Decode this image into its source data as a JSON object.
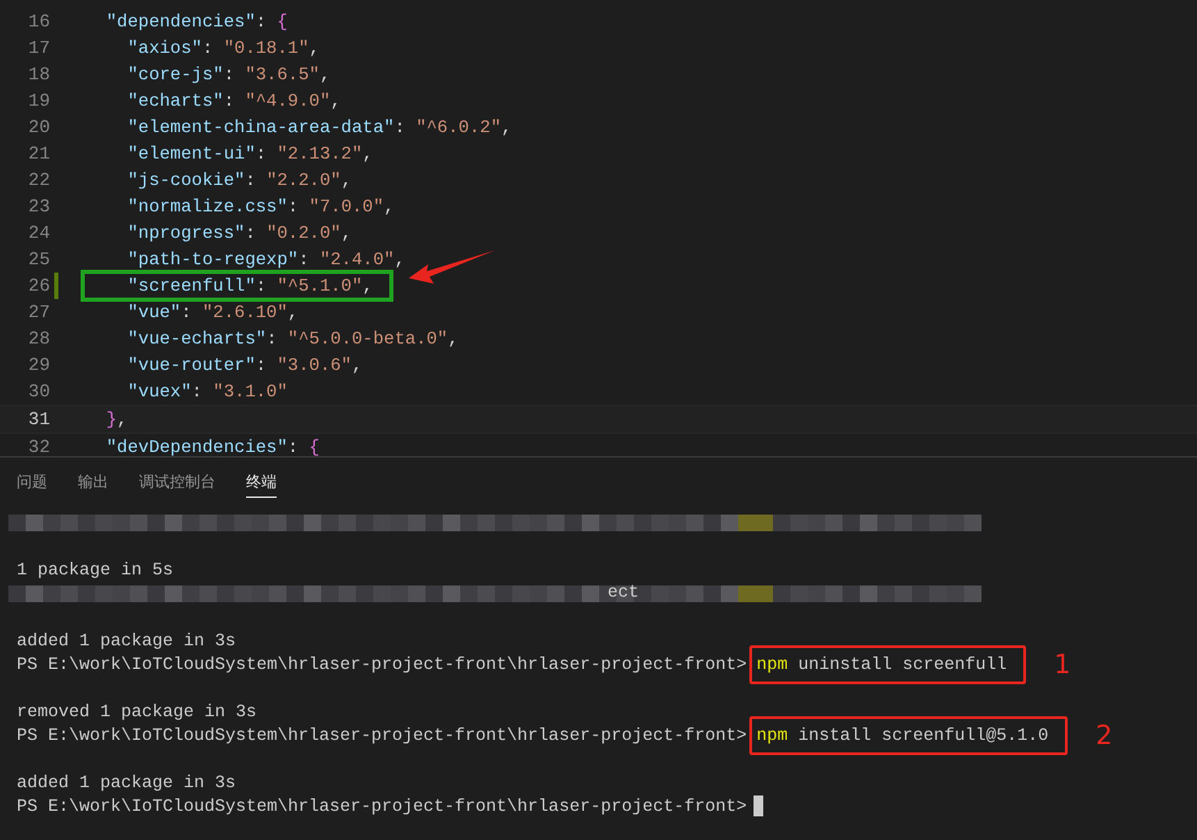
{
  "editor": {
    "lines": [
      {
        "number": "16",
        "current": false,
        "modified": false,
        "annotated": false,
        "tokens": [
          {
            "kind": "key",
            "text": "  \"dependencies\""
          },
          {
            "kind": "punct",
            "text": ": "
          },
          {
            "kind": "brace",
            "text": "{"
          }
        ]
      },
      {
        "number": "17",
        "current": false,
        "modified": false,
        "annotated": false,
        "tokens": [
          {
            "kind": "key",
            "text": "    \"axios\""
          },
          {
            "kind": "punct",
            "text": ": "
          },
          {
            "kind": "string",
            "text": "\"0.18.1\""
          },
          {
            "kind": "punct",
            "text": ","
          }
        ]
      },
      {
        "number": "18",
        "current": false,
        "modified": false,
        "annotated": false,
        "tokens": [
          {
            "kind": "key",
            "text": "    \"core-js\""
          },
          {
            "kind": "punct",
            "text": ": "
          },
          {
            "kind": "string",
            "text": "\"3.6.5\""
          },
          {
            "kind": "punct",
            "text": ","
          }
        ]
      },
      {
        "number": "19",
        "current": false,
        "modified": false,
        "annotated": false,
        "tokens": [
          {
            "kind": "key",
            "text": "    \"echarts\""
          },
          {
            "kind": "punct",
            "text": ": "
          },
          {
            "kind": "string",
            "text": "\"^4.9.0\""
          },
          {
            "kind": "punct",
            "text": ","
          }
        ]
      },
      {
        "number": "20",
        "current": false,
        "modified": false,
        "annotated": false,
        "tokens": [
          {
            "kind": "key",
            "text": "    \"element-china-area-data\""
          },
          {
            "kind": "punct",
            "text": ": "
          },
          {
            "kind": "string",
            "text": "\"^6.0.2\""
          },
          {
            "kind": "punct",
            "text": ","
          }
        ]
      },
      {
        "number": "21",
        "current": false,
        "modified": false,
        "annotated": false,
        "tokens": [
          {
            "kind": "key",
            "text": "    \"element-ui\""
          },
          {
            "kind": "punct",
            "text": ": "
          },
          {
            "kind": "string",
            "text": "\"2.13.2\""
          },
          {
            "kind": "punct",
            "text": ","
          }
        ]
      },
      {
        "number": "22",
        "current": false,
        "modified": false,
        "annotated": false,
        "tokens": [
          {
            "kind": "key",
            "text": "    \"js-cookie\""
          },
          {
            "kind": "punct",
            "text": ": "
          },
          {
            "kind": "string",
            "text": "\"2.2.0\""
          },
          {
            "kind": "punct",
            "text": ","
          }
        ]
      },
      {
        "number": "23",
        "current": false,
        "modified": false,
        "annotated": false,
        "tokens": [
          {
            "kind": "key",
            "text": "    \"normalize.css\""
          },
          {
            "kind": "punct",
            "text": ": "
          },
          {
            "kind": "string",
            "text": "\"7.0.0\""
          },
          {
            "kind": "punct",
            "text": ","
          }
        ]
      },
      {
        "number": "24",
        "current": false,
        "modified": false,
        "annotated": false,
        "tokens": [
          {
            "kind": "key",
            "text": "    \"nprogress\""
          },
          {
            "kind": "punct",
            "text": ": "
          },
          {
            "kind": "string",
            "text": "\"0.2.0\""
          },
          {
            "kind": "punct",
            "text": ","
          }
        ]
      },
      {
        "number": "25",
        "current": false,
        "modified": false,
        "annotated": false,
        "tokens": [
          {
            "kind": "key",
            "text": "    \"path-to-regexp\""
          },
          {
            "kind": "punct",
            "text": ": "
          },
          {
            "kind": "string",
            "text": "\"2.4.0\""
          },
          {
            "kind": "punct",
            "text": ","
          }
        ]
      },
      {
        "number": "26",
        "current": false,
        "modified": true,
        "annotated": true,
        "tokens": [
          {
            "kind": "key",
            "text": "    \"screenfull\""
          },
          {
            "kind": "punct",
            "text": ": "
          },
          {
            "kind": "string",
            "text": "\"^5.1.0\""
          },
          {
            "kind": "punct",
            "text": ","
          }
        ]
      },
      {
        "number": "27",
        "current": false,
        "modified": false,
        "annotated": false,
        "tokens": [
          {
            "kind": "key",
            "text": "    \"vue\""
          },
          {
            "kind": "punct",
            "text": ": "
          },
          {
            "kind": "string",
            "text": "\"2.6.10\""
          },
          {
            "kind": "punct",
            "text": ","
          }
        ]
      },
      {
        "number": "28",
        "current": false,
        "modified": false,
        "annotated": false,
        "tokens": [
          {
            "kind": "key",
            "text": "    \"vue-echarts\""
          },
          {
            "kind": "punct",
            "text": ": "
          },
          {
            "kind": "string",
            "text": "\"^5.0.0-beta.0\""
          },
          {
            "kind": "punct",
            "text": ","
          }
        ]
      },
      {
        "number": "29",
        "current": false,
        "modified": false,
        "annotated": false,
        "tokens": [
          {
            "kind": "key",
            "text": "    \"vue-router\""
          },
          {
            "kind": "punct",
            "text": ": "
          },
          {
            "kind": "string",
            "text": "\"3.0.6\""
          },
          {
            "kind": "punct",
            "text": ","
          }
        ]
      },
      {
        "number": "30",
        "current": false,
        "modified": false,
        "annotated": false,
        "tokens": [
          {
            "kind": "key",
            "text": "    \"vuex\""
          },
          {
            "kind": "punct",
            "text": ": "
          },
          {
            "kind": "string",
            "text": "\"3.1.0\""
          }
        ]
      },
      {
        "number": "31",
        "current": true,
        "modified": false,
        "annotated": false,
        "tokens": [
          {
            "kind": "brace",
            "text": "  }"
          },
          {
            "kind": "punct",
            "text": ","
          }
        ]
      },
      {
        "number": "32",
        "current": false,
        "modified": false,
        "annotated": false,
        "tokens": [
          {
            "kind": "key",
            "text": "  \"devDependencies\""
          },
          {
            "kind": "punct",
            "text": ": "
          },
          {
            "kind": "brace",
            "text": "{"
          }
        ]
      }
    ]
  },
  "panel": {
    "tabs": [
      {
        "label": "问题",
        "selected": false
      },
      {
        "label": "输出",
        "selected": false
      },
      {
        "label": "调试控制台",
        "selected": false
      },
      {
        "label": "终端",
        "selected": true
      }
    ],
    "terminal": [
      {
        "kind": "redacted"
      },
      {
        "kind": "blank"
      },
      {
        "kind": "output",
        "text": "1 package in 5s"
      },
      {
        "kind": "redacted",
        "fragment": "ect"
      },
      {
        "kind": "blank"
      },
      {
        "kind": "output",
        "text": "added 1 package in 3s"
      },
      {
        "kind": "prompt",
        "prompt": "PS E:\\work\\IoTCloudSystem\\hrlaser-project-front\\hrlaser-project-front>",
        "verb": "npm",
        "args": "uninstall screenfull",
        "annotation": "1"
      },
      {
        "kind": "blank"
      },
      {
        "kind": "output",
        "text": "removed 1 package in 3s"
      },
      {
        "kind": "prompt",
        "prompt": "PS E:\\work\\IoTCloudSystem\\hrlaser-project-front\\hrlaser-project-front>",
        "verb": "npm",
        "args": "install screenfull@5.1.0",
        "annotation": "2"
      },
      {
        "kind": "blank"
      },
      {
        "kind": "output",
        "text": "added 1 package in 3s"
      },
      {
        "kind": "cursor",
        "prompt": "PS E:\\work\\IoTCloudSystem\\hrlaser-project-front\\hrlaser-project-front>"
      }
    ]
  }
}
